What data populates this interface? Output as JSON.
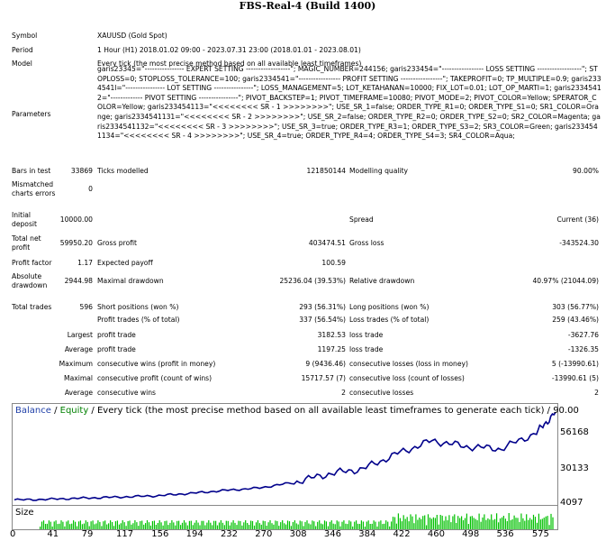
{
  "window_title": "FBS-Real-4 (Build 1400)",
  "settings": {
    "symbol_label": "Symbol",
    "symbol_value": "XAUUSD (Gold Spot)",
    "period_label": "Period",
    "period_value": "1 Hour (H1) 2018.01.02 09:00 - 2023.07.31 23:00 (2018.01.01 - 2023.08.01)",
    "model_label": "Model",
    "model_value": "Every tick (the most precise method based on all available least timeframes)",
    "parameters_label": "Parameters",
    "parameters_value": "garis23345=\"---------------- EXPERT SETTING ------------------\"; MAGIC_NUMBER=244156; garis233454=\"----------------- LOSS SETTING ------------------\"; STOPLOSS=0; STOPLOSS_TOLERANCE=100; garis2334541=\"----------------- PROFIT SETTING -----------------\"; TAKEPROFIT=0; TP_MULTIPLE=0.9; garis2334541l=\"---------------- LOT SETTING ----------------\"; LOSS_MANAGEMENT=5; LOT_KETAHANAN=10000; FIX_LOT=0.01; LOT_OP_MARTI=1; garis2334541 2=\"------------- PIVOT SETTING ----------------\"; PIVOT_BACKSTEP=1; PIVOT_TIMEFRAME=10080; PIVOT_MODE=2; PIVOT_COLOR=Yellow; SPERATOR_COLOR=Yellow; garis233454113=\"<<<<<<<< SR - 1 >>>>>>>>\"; USE_SR_1=false; ORDER_TYPE_R1=0; ORDER_TYPE_S1=0; SR1_COLOR=Orange; garis2334541131=\"<<<<<<<< SR - 2 >>>>>>>>\"; USE_SR_2=false; ORDER_TYPE_R2=0; ORDER_TYPE_S2=0; SR2_COLOR=Magenta; garis2334541132=\"<<<<<<<< SR - 3 >>>>>>>>\"; USE_SR_3=true; ORDER_TYPE_R3=1; ORDER_TYPE_S3=2; SR3_COLOR=Green; garis233454 1134=\"<<<<<<<< SR - 4 >>>>>>>>\"; USE_SR_4=true; ORDER_TYPE_R4=4; ORDER_TYPE_S4=3; SR4_COLOR=Aqua;"
  },
  "stats": {
    "bars_label": "Bars in test",
    "bars_value": "33869",
    "ticks_label": "Ticks modelled",
    "ticks_value": "121850144",
    "quality_label": "Modelling quality",
    "quality_value": "90.00%",
    "mismatched_label": "Mismatched charts errors",
    "mismatched_value": "0",
    "initial_deposit_label": "Initial deposit",
    "initial_deposit_value": "10000.00",
    "spread_label": "Spread",
    "spread_value": "Current (36)",
    "net_profit_label": "Total net profit",
    "net_profit_value": "59950.20",
    "gross_profit_label": "Gross profit",
    "gross_profit_value": "403474.51",
    "gross_loss_label": "Gross loss",
    "gross_loss_value": "-343524.30",
    "profit_factor_label": "Profit factor",
    "profit_factor_value": "1.17",
    "expected_payoff_label": "Expected payoff",
    "expected_payoff_value": "100.59",
    "abs_drawdown_label": "Absolute drawdown",
    "abs_drawdown_value": "2944.98",
    "max_drawdown_label": "Maximal drawdown",
    "max_drawdown_value": "25236.04 (39.53%)",
    "rel_drawdown_label": "Relative drawdown",
    "rel_drawdown_value": "40.97% (21044.09)",
    "total_trades_label": "Total trades",
    "total_trades_value": "596",
    "short_label": "Short positions (won %)",
    "short_value": "293 (56.31%)",
    "long_label": "Long positions (won %)",
    "long_value": "303 (56.77%)",
    "profit_trades_label": "Profit trades (% of total)",
    "profit_trades_value": "337 (56.54%)",
    "loss_trades_label": "Loss trades (% of total)",
    "loss_trades_value": "259 (43.46%)",
    "largest_label": "Largest",
    "largest_profit_label": "profit trade",
    "largest_profit_value": "3182.53",
    "largest_loss_label": "loss trade",
    "largest_loss_value": "-3627.76",
    "average_label": "Average",
    "average_profit_label": "profit trade",
    "average_profit_value": "1197.25",
    "average_loss_label": "loss trade",
    "average_loss_value": "-1326.35",
    "maximum_label": "Maximum",
    "max_cons_wins_label": "consecutive wins (profit in money)",
    "max_cons_wins_value": "9 (9436.46)",
    "max_cons_losses_label": "consecutive losses (loss in money)",
    "max_cons_losses_value": "5 (-13990.61)",
    "maximal_label": "Maximal",
    "maximal_profit_label": "consecutive profit (count of wins)",
    "maximal_profit_value": "15717.57 (7)",
    "maximal_loss_label": "consecutive loss (count of losses)",
    "maximal_loss_value": "-13990.61 (5)",
    "average2_label": "Average",
    "avg_cons_wins_label": "consecutive wins",
    "avg_cons_wins_value": "2",
    "avg_cons_losses_label": "consecutive losses",
    "avg_cons_losses_value": "2"
  },
  "chart": {
    "legend_balance": "Balance",
    "legend_sep": " / ",
    "legend_equity": "Equity",
    "legend_rest": " / Every tick (the most precise method based on all available least timeframes to generate each tick) / 90.00",
    "balance_color": "#00008B",
    "equity_color": "#008000",
    "volume_color": "#00C000",
    "y_ticks": [
      "56168",
      "30133",
      "4097"
    ],
    "size_label": "Size",
    "x_ticks": [
      "0",
      "41",
      "79",
      "117",
      "156",
      "194",
      "232",
      "270",
      "308",
      "346",
      "384",
      "422",
      "460",
      "498",
      "536",
      "575"
    ]
  },
  "chart_data": {
    "type": "line",
    "title": "",
    "xlabel": "",
    "ylabel": "",
    "x": [
      0,
      41,
      79,
      117,
      156,
      194,
      232,
      270,
      308,
      346,
      384,
      422,
      460,
      498,
      536,
      575,
      596
    ],
    "ylim": [
      4097,
      72000
    ],
    "series": [
      {
        "name": "Balance",
        "values": [
          10000,
          10500,
          11300,
          12000,
          12800,
          14500,
          16500,
          18200,
          22000,
          27800,
          31300,
          41800,
          50600,
          46500,
          45000,
          56000,
          70000
        ]
      }
    ]
  }
}
